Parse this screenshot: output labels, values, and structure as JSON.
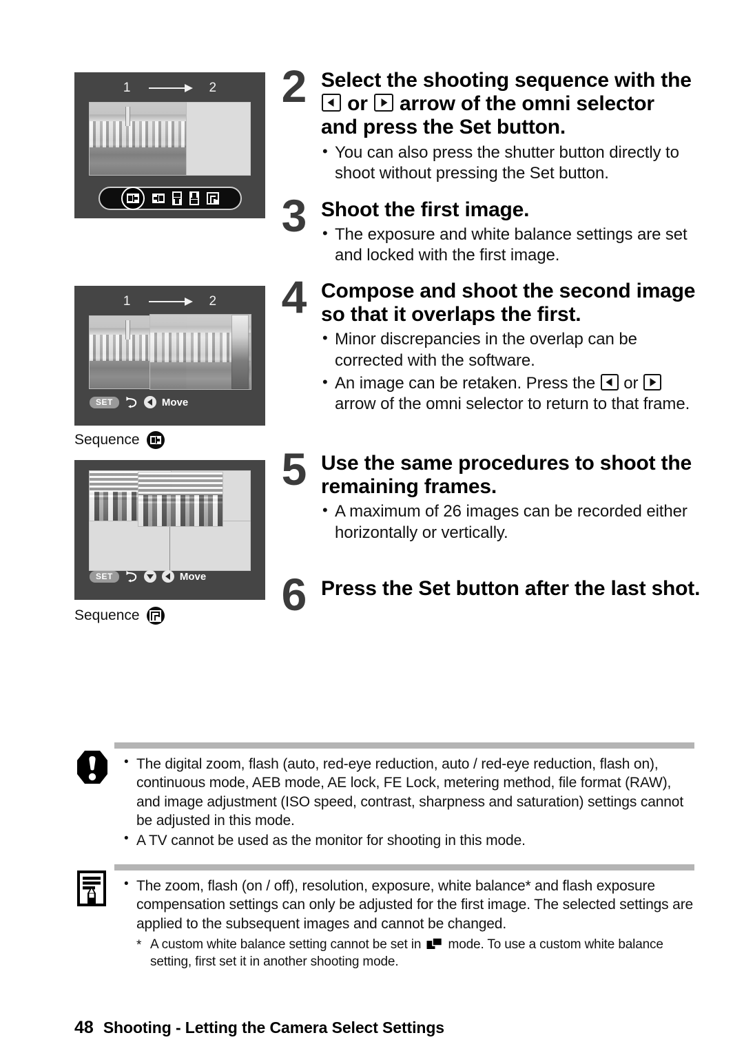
{
  "page": {
    "number": "48",
    "section_title": "Shooting - Letting the Camera Select Settings"
  },
  "screens": [
    {
      "name": "stitch-assist-first-frame",
      "header_left": "1",
      "header_right": "2",
      "arrow": "right-arrow",
      "mode_icons": [
        "stitch-horizontal-left-to-right",
        "stitch-horizontal-right-to-left",
        "stitch-vertical-up",
        "stitch-vertical-down",
        "stitch-square-grid"
      ],
      "selected_mode_index": 0
    },
    {
      "name": "stitch-assist-second-frame",
      "header_left": "1",
      "header_right": "2",
      "arrow": "right-arrow",
      "setbar": {
        "set_label": "SET",
        "return_icon": "return-arrow-icon",
        "direction_icons": [
          "left-arrow-icon"
        ],
        "move_label": "Move"
      },
      "caption": {
        "label": "Sequence",
        "badge_icon": "stitch-horizontal-left-to-right"
      }
    },
    {
      "name": "stitch-assist-grid-frame",
      "setbar": {
        "set_label": "SET",
        "return_icon": "return-arrow-icon",
        "direction_icons": [
          "down-arrow-icon",
          "left-arrow-icon"
        ],
        "move_label": "Move"
      },
      "caption": {
        "label": "Sequence",
        "badge_icon": "stitch-square-grid"
      }
    }
  ],
  "steps": [
    {
      "number": "2",
      "title_parts": [
        "Select the shooting sequence with the ",
        "[left-key]",
        " or ",
        "[right-key]",
        " arrow of the omni selector and press the Set button."
      ],
      "title_line1": "Select the shooting sequence with the",
      "title_line2_pre": " or ",
      "title_line2_post": " arrow of the omni selector",
      "title_line3": "and press the Set button.",
      "bullets": [
        "You can also press the shutter button directly to shoot without pressing the Set button."
      ]
    },
    {
      "number": "3",
      "title_line1": "Shoot the first image.",
      "bullets": [
        "The exposure and white balance settings are set and locked with the first image."
      ]
    },
    {
      "number": "4",
      "title_line1": "Compose and shoot the second image",
      "title_line3": "so that it overlaps the first.",
      "bullets": [
        "Minor discrepancies in the overlap can be corrected with the software."
      ],
      "bullet_with_keys_pre": "An image can be retaken. Press the ",
      "bullet_with_keys_mid": " or ",
      "bullet_with_keys_post": " arrow of the omni selector to return to that frame."
    },
    {
      "number": "5",
      "title_line1": "Use the same procedures to shoot the",
      "title_line3": "remaining frames.",
      "bullets": [
        "A maximum of 26 images can be recorded either horizontally or vertically."
      ]
    },
    {
      "number": "6",
      "title_line1": "Press the Set button after the last shot.",
      "bullets": []
    }
  ],
  "callouts": [
    {
      "icon": "warning-octagon-icon",
      "bullets": [
        "The digital zoom, flash (auto, red-eye reduction, auto / red-eye reduction, flash on), continuous mode, AEB mode, AE lock, FE Lock, metering method, file format (RAW), and image adjustment (ISO speed, contrast, sharpness and saturation) settings cannot be adjusted in this mode.",
        "A TV cannot be used as the monitor for shooting in this mode."
      ]
    },
    {
      "icon": "note-document-pencil-icon",
      "bullets": [
        "The zoom, flash (on / off), resolution, exposure, white balance* and flash exposure compensation settings can only be adjusted for the first image. The selected settings are applied to the subsequent images and cannot be changed."
      ],
      "footnote_marker": "*",
      "footnote_pre": "A custom white balance setting cannot be set in ",
      "footnote_post": " mode. To use a custom white balance setting, first set it in another shooting mode.",
      "footnote_icon": "stitch-assist-mode-icon"
    }
  ],
  "colors": {
    "screen_background": "#454545",
    "frame_slot": "#dcdcdc",
    "rule": "#b4b4b4",
    "step_number": "#3b3b3b"
  }
}
